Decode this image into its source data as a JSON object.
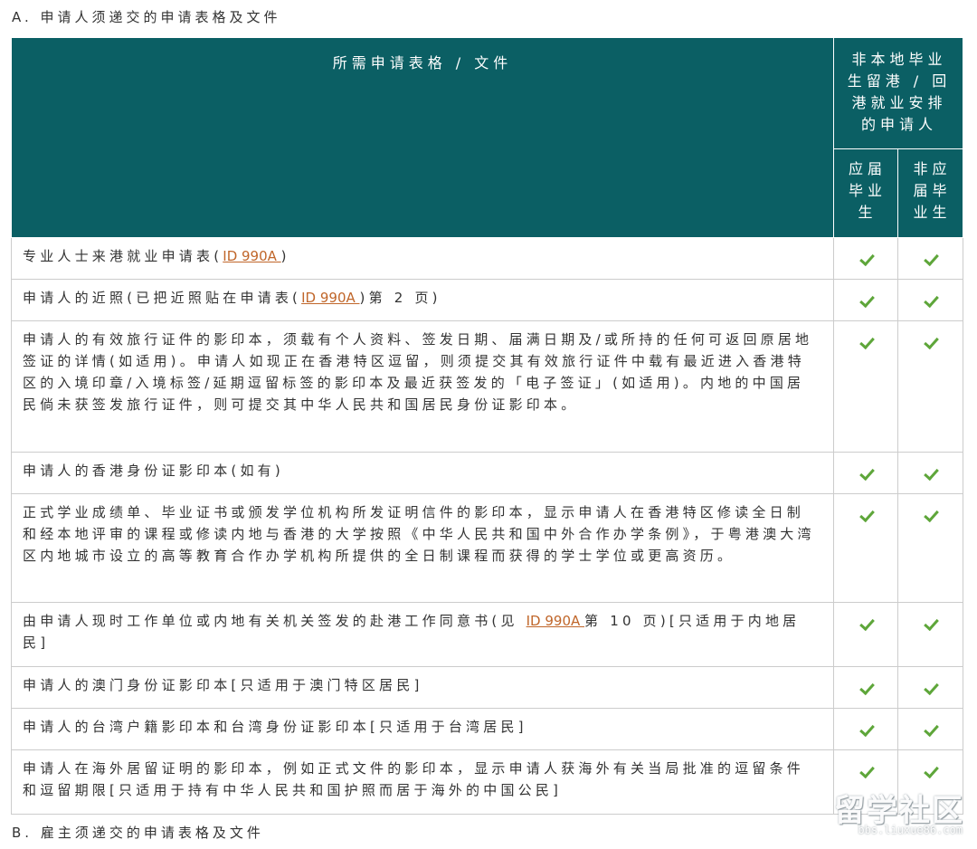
{
  "section_a_title": "A. 申请人须递交的申请表格及文件",
  "section_b_title": "B. 雇主须递交的申请表格及文件",
  "table": {
    "header_docs": "所需申请表格 / 文件",
    "header_group": "非本地毕业生留港 / 回港就业安排的申请人",
    "header_col1": "应届毕业生",
    "header_col2": "非应届毕业生",
    "rows": [
      {
        "pre": "专业人士来港就业申请表(",
        "link": "ID 990A ",
        "post": ")",
        "c1": true,
        "c2": true
      },
      {
        "pre": "申请人的近照(已把近照贴在申请表(",
        "link": "ID 990A ",
        "post": ")第 2 页)",
        "c1": true,
        "c2": true
      },
      {
        "pre": "申请人的有效旅行证件的影印本，须载有个人资料、签发日期、届满日期及/或所持的任何可返回原居地签证的详情(如适用)。申请人如现正在香港特区逗留，则须提交其有效旅行证件中载有最近进入香港特区的入境印章/入境标签/延期逗留标签的影印本及最近获签发的「电子签证」(如适用)。内地的中国居民倘未获签发旅行证件，则可提交其中华人民共和国居民身份证影印本。",
        "link": "",
        "post": "",
        "c1": true,
        "c2": true
      },
      {
        "pre": "申请人的香港身份证影印本(如有)",
        "link": "",
        "post": "",
        "c1": true,
        "c2": true
      },
      {
        "pre": "正式学业成绩单、毕业证书或颁发学位机构所发证明信件的影印本，显示申请人在香港特区修读全日制和经本地评审的课程或修读内地与香港的大学按照《中华人民共和国中外合作办学条例》，于粤港澳大湾区内地城市设立的高等教育合作办学机构所提供的全日制课程而获得的学士学位或更高资历。",
        "link": "",
        "post": "",
        "c1": true,
        "c2": true
      },
      {
        "pre": "由申请人现时工作单位或内地有关机关签发的赴港工作同意书(见 ",
        "link": "ID 990A ",
        "post": "第 10 页)[只适用于内地居民]",
        "c1": true,
        "c2": true
      },
      {
        "pre": "申请人的澳门身份证影印本[只适用于澳门特区居民]",
        "link": "",
        "post": "",
        "c1": true,
        "c2": true
      },
      {
        "pre": "申请人的台湾户籍影印本和台湾身份证影印本[只适用于台湾居民]",
        "link": "",
        "post": "",
        "c1": true,
        "c2": true
      },
      {
        "pre": "申请人在海外居留证明的影印本，例如正式文件的影印本，显示申请人获海外有关当局批准的逗留条件和逗留期限[只适用于持有中华人民共和国护照而居于海外的中国公民]",
        "link": "",
        "post": "",
        "c1": true,
        "c2": true
      }
    ]
  },
  "watermark": {
    "text": "留学社区",
    "url": "bbs.liuxue86.com"
  },
  "colors": {
    "header_bg": "#0b5f64",
    "check": "#5ea63a",
    "link": "#c0662a"
  }
}
